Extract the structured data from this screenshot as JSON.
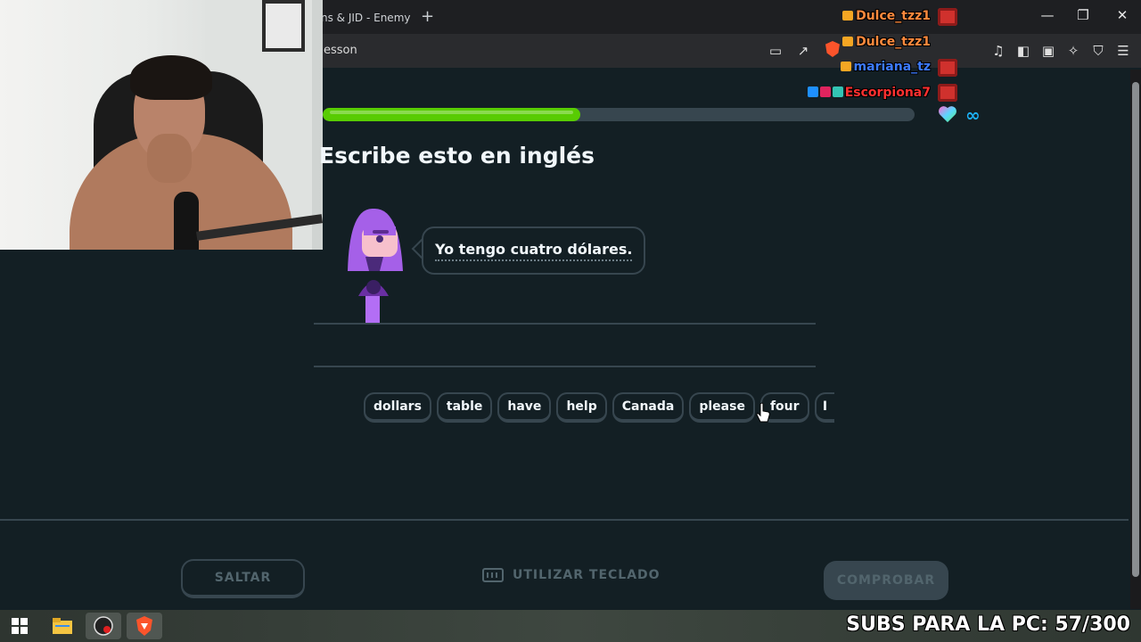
{
  "browser": {
    "tab_title": "ns & JID - Enemy",
    "url_fragment": "esson",
    "new_tab_icon": "plus-icon"
  },
  "chat": {
    "messages": [
      {
        "user": "Dulce_tzz1",
        "color": "#ff8a3d"
      },
      {
        "user": "Dulce_tzz1",
        "color": "#ff8a3d"
      },
      {
        "user": "mariana_tz",
        "color": "#3d7bff"
      },
      {
        "user": "Escorpiona7",
        "color": "#ff3030"
      }
    ]
  },
  "progress": {
    "value": 0.435,
    "color": "#58cc02",
    "infinity": "∞"
  },
  "lesson": {
    "title": "Escribe esto en inglés",
    "prompt": "Yo tengo cuatro dólares.",
    "word_bank": [
      "dollars",
      "table",
      "have",
      "help",
      "Canada",
      "please",
      "four",
      "I"
    ]
  },
  "footer": {
    "skip_label": "SALTAR",
    "keyboard_label": "UTILIZAR TECLADO",
    "check_label": "COMPROBAR"
  },
  "overlay": {
    "subs_text": "SUBS PARA LA PC: 57/300"
  }
}
